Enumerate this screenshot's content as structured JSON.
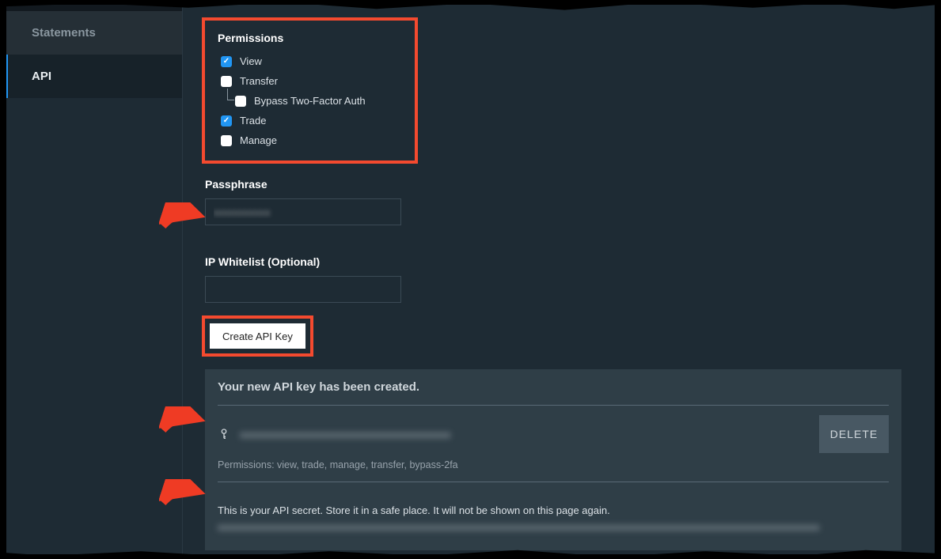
{
  "sidebar": {
    "items": [
      {
        "label": "Statements",
        "active": false
      },
      {
        "label": "API",
        "active": true
      }
    ]
  },
  "permissions": {
    "title": "Permissions",
    "items": {
      "view": {
        "label": "View",
        "checked": true
      },
      "transfer": {
        "label": "Transfer",
        "checked": false
      },
      "bypass2fa": {
        "label": "Bypass Two-Factor Auth",
        "checked": false
      },
      "trade": {
        "label": "Trade",
        "checked": true
      },
      "manage": {
        "label": "Manage",
        "checked": false
      }
    }
  },
  "passphrase": {
    "label": "Passphrase",
    "value": "xxxxxxxxxxx"
  },
  "whitelist": {
    "label": "IP Whitelist (Optional)",
    "value": ""
  },
  "create_button": "Create API Key",
  "result": {
    "title": "Your new API key has been created.",
    "key_value": "xxxxxxxxxxxxxxxxxxxxxxxxxxxxxxxxxxxxxxxxx",
    "permissions_line": "Permissions: view, trade, manage, transfer, bypass-2fa",
    "secret_warn": "This is your API secret. Store it in a safe place. It will not be shown on this page again.",
    "secret_value": "xxxxxxxxxxxxxxxxxxxxxxxxxxxxxxxxxxxxxxxxxxxxxxxxxxxxxxxxxxxxxxxxxxxxxxxxxxxxxxxxxxxxxxxxxxxxxxxxxxxxxxxxxxxxxxxxxxxxx",
    "delete_label": "DELETE"
  },
  "colors": {
    "highlight": "#f44a2f",
    "accent": "#2196f3",
    "bg": "#1e2b34"
  }
}
